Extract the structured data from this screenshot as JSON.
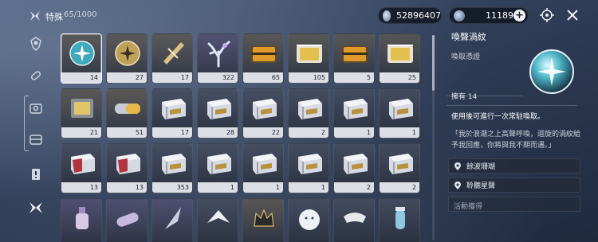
{
  "header": {
    "category_icon": "butterfly-icon",
    "category_name": "特殊",
    "category_count": "65/1000"
  },
  "currencies": [
    {
      "icon": "shell-coin-icon",
      "value": "52896407"
    },
    {
      "icon": "astrite-star-icon",
      "value": "11189",
      "add_label": "+"
    }
  ],
  "toolbar_icons": [
    "target-settings-icon",
    "close-icon"
  ],
  "nav": {
    "items": [
      {
        "icon": "emblem-icon"
      },
      {
        "icon": "capsule-icon"
      },
      {
        "icon": "bag-icon"
      },
      {
        "icon": "chest-icon"
      },
      {
        "icon": "alert-card-icon"
      },
      {
        "icon": "butterfly-icon",
        "active": true
      }
    ]
  },
  "grid": {
    "items": [
      {
        "name": "喚聲渦紋",
        "qty": "14",
        "art": "orb",
        "rarity": "gold",
        "selected": true
      },
      {
        "name": "coin-medal",
        "qty": "27",
        "art": "medal",
        "rarity": "gold"
      },
      {
        "name": "gold-crystal",
        "qty": "17",
        "art": "crystal-gold",
        "rarity": "gold"
      },
      {
        "name": "coral",
        "qty": "322",
        "art": "coral",
        "rarity": "purple"
      },
      {
        "name": "gold-chest-a",
        "qty": "65",
        "art": "chest-amber",
        "rarity": "gold"
      },
      {
        "name": "gold-chest-b",
        "qty": "105",
        "art": "chest-gold",
        "rarity": "gold"
      },
      {
        "name": "gold-chest-c",
        "qty": "5",
        "art": "chest-amber",
        "rarity": "gold"
      },
      {
        "name": "gold-chest-d",
        "qty": "25",
        "art": "chest-gold",
        "rarity": "gold"
      },
      {
        "name": "capsule-box",
        "qty": "21",
        "art": "capsule-box",
        "rarity": "gold"
      },
      {
        "name": "capsule",
        "qty": "51",
        "art": "capsule",
        "rarity": "gold"
      },
      {
        "name": "silver-chest-1",
        "qty": "17",
        "art": "chest-silver",
        "rarity": "none"
      },
      {
        "name": "silver-chest-2",
        "qty": "28",
        "art": "chest-silver",
        "rarity": "none"
      },
      {
        "name": "silver-chest-3",
        "qty": "22",
        "art": "chest-silver",
        "rarity": "none"
      },
      {
        "name": "silver-chest-4",
        "qty": "2",
        "art": "chest-silver",
        "rarity": "none"
      },
      {
        "name": "silver-chest-5",
        "qty": "1",
        "art": "chest-silver",
        "rarity": "none"
      },
      {
        "name": "silver-chest-6",
        "qty": "1",
        "art": "chest-silver",
        "rarity": "none"
      },
      {
        "name": "red-chest-1",
        "qty": "13",
        "art": "chest-red",
        "rarity": "none"
      },
      {
        "name": "red-chest-2",
        "qty": "13",
        "art": "chest-red",
        "rarity": "none"
      },
      {
        "name": "silver-chest-7",
        "qty": "353",
        "art": "chest-silver",
        "rarity": "none"
      },
      {
        "name": "silver-chest-8",
        "qty": "1",
        "art": "chest-silver",
        "rarity": "none"
      },
      {
        "name": "silver-chest-9",
        "qty": "1",
        "art": "chest-silver",
        "rarity": "none"
      },
      {
        "name": "silver-chest-10",
        "qty": "1",
        "art": "chest-silver",
        "rarity": "none"
      },
      {
        "name": "silver-chest-11",
        "qty": "2",
        "art": "chest-silver",
        "rarity": "none"
      },
      {
        "name": "silver-chest-12",
        "qty": "2",
        "art": "chest-silver",
        "rarity": "none"
      },
      {
        "name": "ink-bottle",
        "qty": "",
        "art": "bottle",
        "rarity": "purple"
      },
      {
        "name": "scroll-pen",
        "qty": "",
        "art": "scroll",
        "rarity": "purple"
      },
      {
        "name": "feather",
        "qty": "",
        "art": "feather",
        "rarity": "purple"
      },
      {
        "name": "paper-crane",
        "qty": "",
        "art": "crane",
        "rarity": "none"
      },
      {
        "name": "crown-shard",
        "qty": "",
        "art": "crown",
        "rarity": "gold"
      },
      {
        "name": "snow-doll",
        "qty": "",
        "art": "snowball",
        "rarity": "none"
      },
      {
        "name": "mask",
        "qty": "",
        "art": "mask",
        "rarity": "none"
      },
      {
        "name": "vial",
        "qty": "",
        "art": "vial",
        "rarity": "none"
      }
    ]
  },
  "detail": {
    "title": "喚聲渦紋",
    "subtitle": "喚取憑證",
    "owned_label": "擁有",
    "owned_value": "14",
    "description": "使用後可進行一次常駐喚取。",
    "quote": "「我於浪潮之上高聲呼喚，迴旋的渦紋給予我回應，你將與我不期而遇。」",
    "sources": [
      {
        "icon": "location-pin-icon",
        "label": "餘波珊瑚"
      },
      {
        "icon": "location-pin-icon",
        "label": "聆聽星聲"
      }
    ],
    "more_source": "活動獲得"
  }
}
